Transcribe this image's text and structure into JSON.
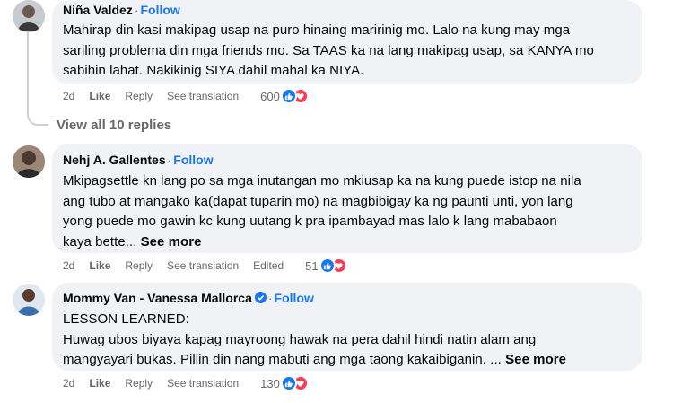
{
  "comments": [
    {
      "author": "Niña Valdez",
      "separator": "·",
      "follow": "Follow",
      "lines": [
        "Mahirap din kasi makipag usap na puro hinaing maririnig mo. Lalo na kung may mga",
        "sariling problema din mga friends mo. Sa TAAS ka na lang makipag usap, sa KANYA mo",
        "sabihin lahat. Nakikinig SIYA dahil mahal ka NIYA."
      ],
      "see_more": "",
      "time": "2d",
      "like": "Like",
      "reply": "Reply",
      "see_translation": "See translation",
      "edited": "",
      "reaction_count": "600",
      "reactions": [
        "like-icon",
        "love-icon"
      ]
    },
    {
      "author": "Nehj A. Gallentes",
      "separator": "·",
      "follow": "Follow",
      "lines": [
        "Mkipagsettle kn lang po sa mga inutangan mo mkiusap ka na kung puede istop na nila",
        "ang tubo at mangako ka(dapat tuparin mo) na magbibigay ka ng paunti unti, yon lang",
        "yong puede mo gawin kc kung uutang k pra ipambayad mas lalo k lang mababaon",
        "kaya bette..."
      ],
      "see_more": "See more",
      "time": "2d",
      "like": "Like",
      "reply": "Reply",
      "see_translation": "See translation",
      "edited": "Edited",
      "reaction_count": "51",
      "reactions": [
        "like-icon",
        "love-icon"
      ]
    },
    {
      "author": "Mommy Van - Vanessa Mallorca",
      "separator": "·",
      "follow": "Follow",
      "lines": [
        "LESSON LEARNED:",
        "Huwag ubos biyaya kapag mayroong hawak na pera dahil hindi natin alam ang",
        "mangyayari bukas. Piliin din nang mabuti ang mga taong kakaibiganin. ..."
      ],
      "see_more": "See more",
      "time": "2d",
      "like": "Like",
      "reply": "Reply",
      "see_translation": "See translation",
      "edited": "",
      "reaction_count": "130",
      "reactions": [
        "like-icon",
        "love-icon"
      ]
    }
  ],
  "view_replies": "View all 10 replies",
  "colors": {
    "bubble": "#f0f2f5",
    "follow": "#1877f2",
    "muted": "#65676b",
    "like": "#1877f2",
    "love": "#f33e58"
  }
}
